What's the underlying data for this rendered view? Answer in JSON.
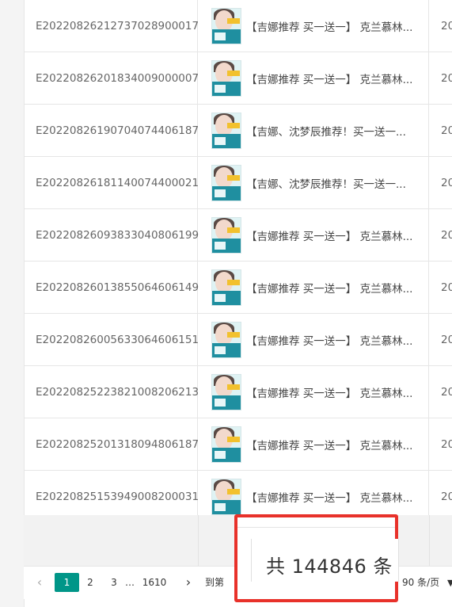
{
  "rows": [
    {
      "order_id": "E20220826212737028900017",
      "product": "【吉娜推荐 买一送一】 克兰慕林...",
      "date": "20"
    },
    {
      "order_id": "E20220826201834009000007",
      "product": "【吉娜推荐 买一送一】 克兰慕林...",
      "date": "20"
    },
    {
      "order_id": "E20220826190704074406187",
      "product": "【吉娜、沈梦辰推荐！买一送一...",
      "date": "20"
    },
    {
      "order_id": "E20220826181140074400021",
      "product": "【吉娜、沈梦辰推荐！买一送一...",
      "date": "20"
    },
    {
      "order_id": "E20220826093833040806199",
      "product": "【吉娜推荐 买一送一】 克兰慕林...",
      "date": "20"
    },
    {
      "order_id": "E20220826013855064606149",
      "product": "【吉娜推荐 买一送一】 克兰慕林...",
      "date": "20"
    },
    {
      "order_id": "E20220826005633064606151",
      "product": "【吉娜推荐 买一送一】 克兰慕林...",
      "date": "20"
    },
    {
      "order_id": "E20220825223821008206213",
      "product": "【吉娜推荐 买一送一】 克兰慕林...",
      "date": "20"
    },
    {
      "order_id": "E20220825201318094806187",
      "product": "【吉娜推荐 买一送一】 克兰慕林...",
      "date": "20"
    },
    {
      "order_id": "E20220825153949008200031",
      "product": "【吉娜推荐 买一送一】 克兰慕林...",
      "date": "20"
    }
  ],
  "pagination": {
    "prev_icon": "‹",
    "pages": [
      "1",
      "2",
      "3"
    ],
    "ellipsis": "…",
    "last_page": "1610",
    "next_icon": "›",
    "goto_label": "到第",
    "per_page": "90 条/页",
    "per_page_caret": "▼"
  },
  "total_popup": {
    "text": "共 144846 条"
  },
  "colors": {
    "accent": "#009688",
    "highlight_border": "#e8312a"
  },
  "icons": {
    "product_thumbnail": "product-thumbnail-icon"
  }
}
